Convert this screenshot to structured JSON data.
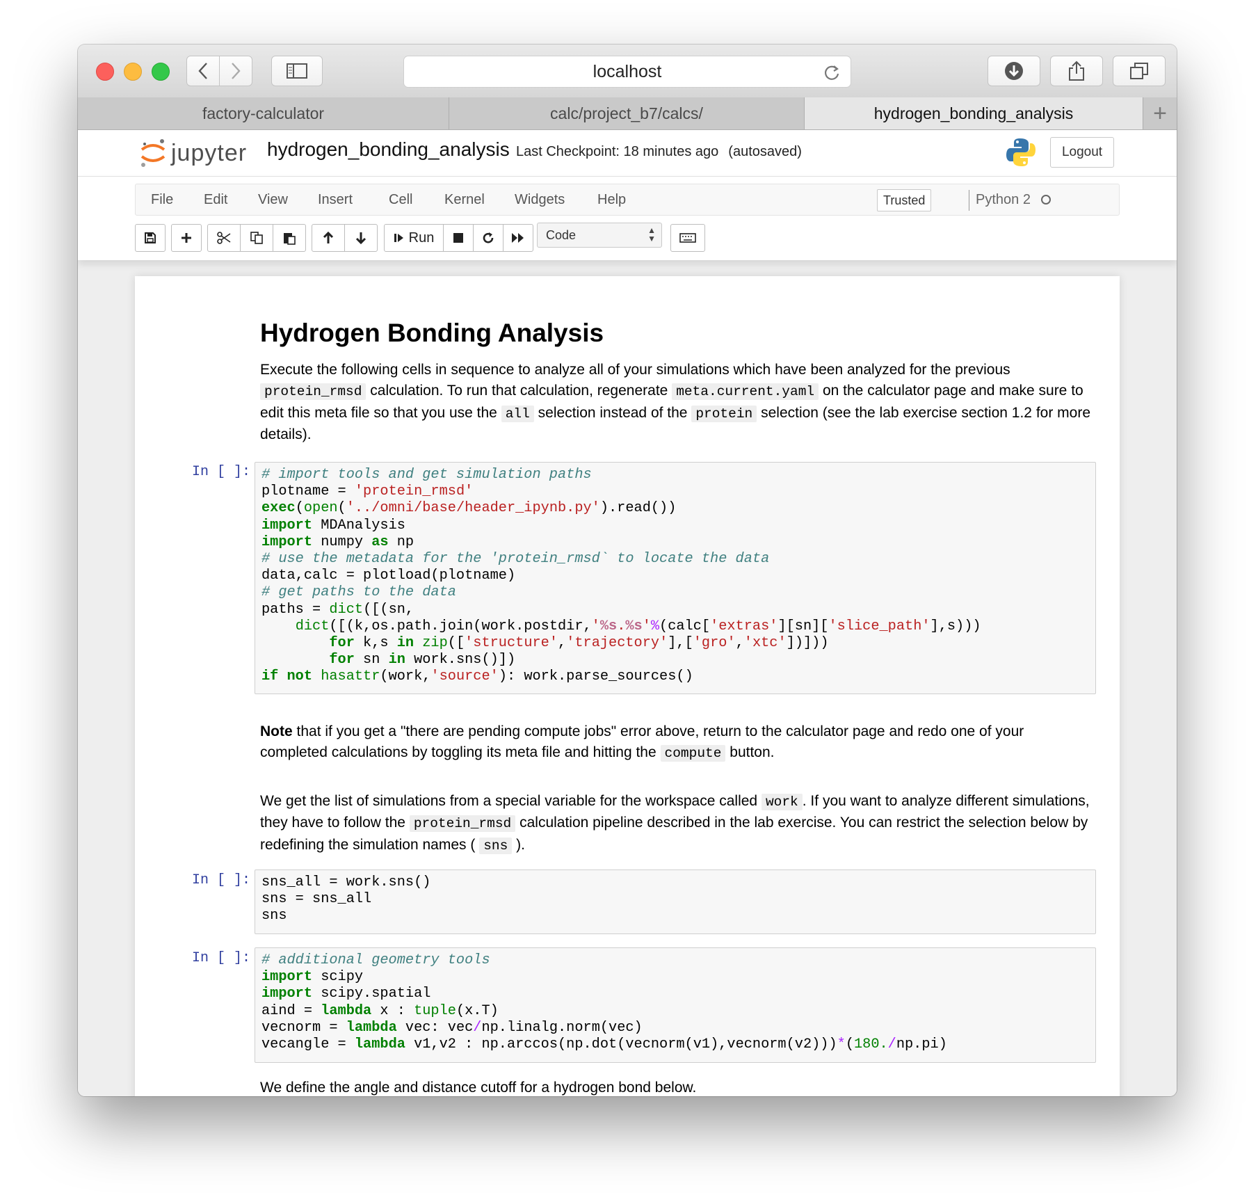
{
  "browser": {
    "url": "localhost",
    "tabs": [
      "factory-calculator",
      "calc/project_b7/calcs/",
      "hydrogen_bonding_analysis"
    ],
    "active_tab": 2
  },
  "jupyter": {
    "logo_text": "jupyter",
    "notebook_name": "hydrogen_bonding_analysis",
    "checkpoint": "Last Checkpoint: 18 minutes ago",
    "autosave": "(autosaved)",
    "logout": "Logout",
    "menu": [
      "File",
      "Edit",
      "Insert",
      "Cell",
      "Kernel",
      "Widgets",
      "Help"
    ],
    "menu_view": "View",
    "trusted": "Trusted",
    "kernel": "Python 2",
    "run_label": "Run",
    "cell_type": "Code"
  },
  "notebook": {
    "title": "Hydrogen Bonding Analysis",
    "intro": {
      "p1": "Execute the following cells in sequence to analyze all of your simulations which have been analyzed for the previous",
      "c1": "protein_rmsd",
      "p2": "calculation. To run that calculation, regenerate",
      "c2": "meta.current.yaml",
      "p3": "on the calculator page and make sure to edit this meta file so that you use the",
      "c3": "all",
      "p4": "selection instead of the",
      "c4": "protein",
      "p5": "selection (see the lab exercise section 1.2 for more details)."
    },
    "prompt": "In [ ]:",
    "note": {
      "bold": "Note",
      "p1": "that if you get a \"there are pending compute jobs\" error above, return to the calculator page and redo one of your completed calculations by toggling its meta file and hitting the",
      "c1": "compute",
      "p2": "button."
    },
    "list_para": {
      "p1": "We get the list of simulations from a special variable for the workspace called",
      "c1": "work",
      "p2": ". If you want to analyze different simulations, they have to follow the",
      "c2": "protein_rmsd",
      "p3": "calculation pipeline described in the lab exercise. You can restrict the selection below by redefining the simulation names (",
      "c3": "sns",
      "p4": ")."
    },
    "cutoff_text": "We define the angle and distance cutoff for a hydrogen bond below.",
    "cells": {
      "cell1": "# import tools and get simulation paths\nplotname = 'protein_rmsd'\nexec(open('../omni/base/header_ipynb.py').read())\nimport MDAnalysis\nimport numpy as np\n# use the metadata for the 'protein_rmsd` to locate the data\ndata,calc = plotload(plotname)\n# get paths to the data\npaths = dict([(sn,\n    dict([(k,os.path.join(work.postdir,'%s.%s'%(calc['extras'][sn]['slice_path'],s)))\n        for k,s in zip(['structure','trajectory'],['gro','xtc'])]))\n        for sn in work.sns()])\nif not hasattr(work,'source'): work.parse_sources()",
      "cell2": "sns_all = work.sns()\nsns = sns_all\nsns",
      "cell3": "# additional geometry tools\nimport scipy\nimport scipy.spatial\naind = lambda x : tuple(x.T)\nvecnorm = lambda vec: vec/np.linalg.norm(vec)\nvecangle = lambda v1,v2 : np.arccos(np.dot(vecnorm(v1),vecnorm(v2)))*(180./np.pi)"
    }
  }
}
